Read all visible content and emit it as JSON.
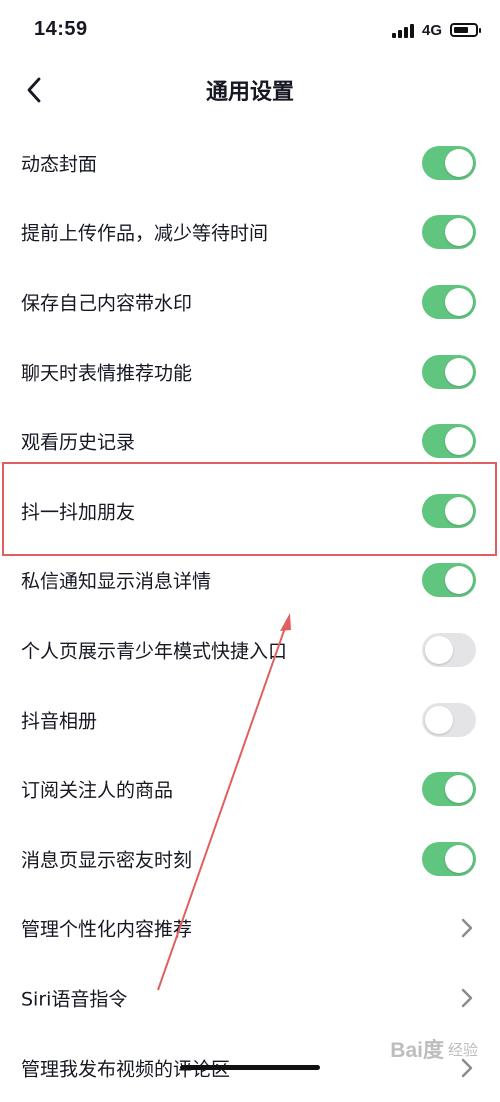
{
  "status_bar": {
    "time": "14:59",
    "network": "4G",
    "battery_level": 0.7
  },
  "nav": {
    "title": "通用设置",
    "back_icon": "chevron-left-icon"
  },
  "settings": [
    {
      "label": "动态封面",
      "type": "toggle",
      "on": true
    },
    {
      "label": "提前上传作品，减少等待时间",
      "type": "toggle",
      "on": true
    },
    {
      "label": "保存自己内容带水印",
      "type": "toggle",
      "on": true
    },
    {
      "label": "聊天时表情推荐功能",
      "type": "toggle",
      "on": true
    },
    {
      "label": "观看历史记录",
      "type": "toggle",
      "on": true
    },
    {
      "label": "抖一抖加朋友",
      "type": "toggle",
      "on": true
    },
    {
      "label": "私信通知显示消息详情",
      "type": "toggle",
      "on": true
    },
    {
      "label": "个人页展示青少年模式快捷入口",
      "type": "toggle",
      "on": false
    },
    {
      "label": "抖音相册",
      "type": "toggle",
      "on": false
    },
    {
      "label": "订阅关注人的商品",
      "type": "toggle",
      "on": true
    },
    {
      "label": "消息页显示密友时刻",
      "type": "toggle",
      "on": true
    },
    {
      "label": "管理个性化内容推荐",
      "type": "link"
    },
    {
      "label": "Siri语音指令",
      "type": "link"
    },
    {
      "label": "管理我发布视频的评论区",
      "type": "link"
    }
  ],
  "colors": {
    "toggle_on": "#60c57f",
    "toggle_off": "#e4e4e6",
    "annotation": "#e06060"
  },
  "watermark": {
    "logo": "Bai度",
    "sub": "经验"
  }
}
